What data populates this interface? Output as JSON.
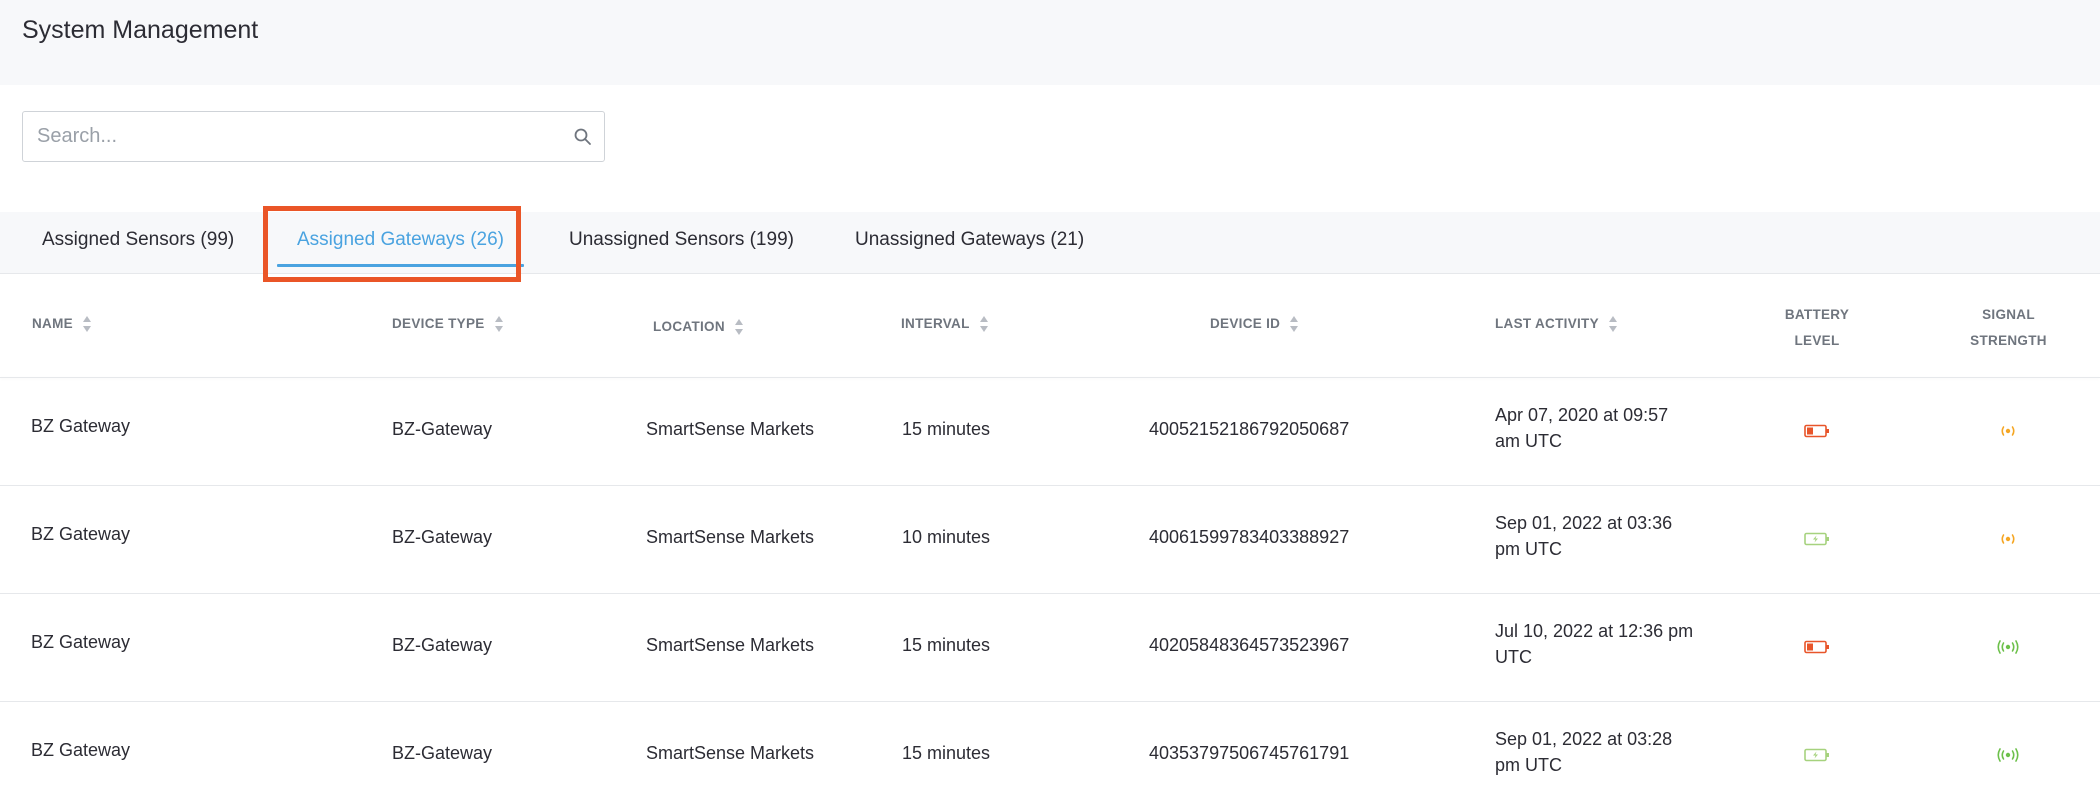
{
  "page": {
    "title": "System Management"
  },
  "search": {
    "placeholder": "Search...",
    "value": ""
  },
  "tabs": [
    {
      "label": "Assigned Sensors (99)",
      "active": false
    },
    {
      "label": "Assigned Gateways (26)",
      "active": true
    },
    {
      "label": "Unassigned Sensors (199)",
      "active": false
    },
    {
      "label": "Unassigned Gateways (21)",
      "active": false
    }
  ],
  "columns": {
    "name": "NAME",
    "device_type": "DEVICE TYPE",
    "location": "LOCATION",
    "interval": "INTERVAL",
    "device_id": "DEVICE ID",
    "last_activity": "LAST ACTIVITY",
    "battery_level": [
      "BATTERY",
      "LEVEL"
    ],
    "signal_strength": [
      "SIGNAL",
      "STRENGTH"
    ]
  },
  "colors": {
    "accent": "#4aa3e0",
    "highlight": "#ea5527",
    "battery_low": "#e8552a",
    "battery_ok": "#a6d27e",
    "signal_medium": "#f5a623",
    "signal_strong": "#6cc04a"
  },
  "rows": [
    {
      "name": "BZ Gateway",
      "device_type": "BZ-Gateway",
      "location": "SmartSense Markets",
      "interval": "15 minutes",
      "device_id": "40052152186792050687",
      "last_activity": "Apr 07, 2020 at 09:57 am UTC",
      "battery": "low",
      "signal": "medium"
    },
    {
      "name": "BZ Gateway",
      "device_type": "BZ-Gateway",
      "location": "SmartSense Markets",
      "interval": "10 minutes",
      "device_id": "40061599783403388927",
      "last_activity": "Sep 01, 2022 at 03:36 pm UTC",
      "battery": "charging",
      "signal": "medium"
    },
    {
      "name": "BZ Gateway",
      "device_type": "BZ-Gateway",
      "location": "SmartSense Markets",
      "interval": "15 minutes",
      "device_id": "40205848364573523967",
      "last_activity": "Jul 10, 2022 at 12:36 pm UTC",
      "battery": "low",
      "signal": "strong"
    },
    {
      "name": "BZ Gateway",
      "device_type": "BZ-Gateway",
      "location": "SmartSense Markets",
      "interval": "15 minutes",
      "device_id": "40353797506745761791",
      "last_activity": "Sep 01, 2022 at 03:28 pm UTC",
      "battery": "charging",
      "signal": "strong"
    }
  ]
}
